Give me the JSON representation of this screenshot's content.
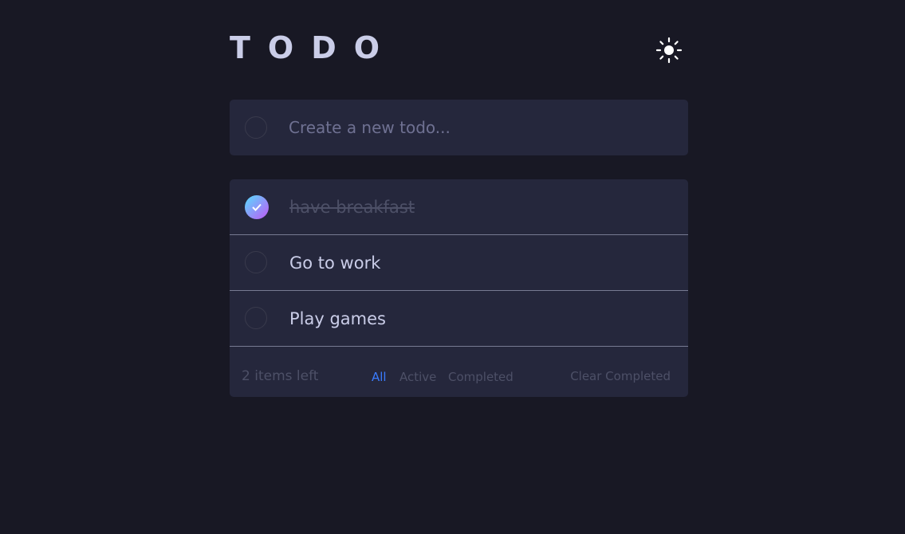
{
  "header": {
    "title": "TODO",
    "theme_icon": "sun-icon"
  },
  "create": {
    "placeholder": "Create a new todo..."
  },
  "todos": [
    {
      "label": "have breakfast",
      "completed": true
    },
    {
      "label": "Go to work",
      "completed": false
    },
    {
      "label": "Play games",
      "completed": false
    }
  ],
  "footer": {
    "items_left": "2 items left",
    "filters": [
      "All",
      "Active",
      "Completed"
    ],
    "active_filter": "All",
    "clear_label": "Clear Completed"
  },
  "colors": {
    "background": "#181824",
    "card": "#25273c",
    "accent": "#3a7bfd",
    "check_gradient_start": "#57ddff",
    "check_gradient_end": "#c058f3"
  }
}
